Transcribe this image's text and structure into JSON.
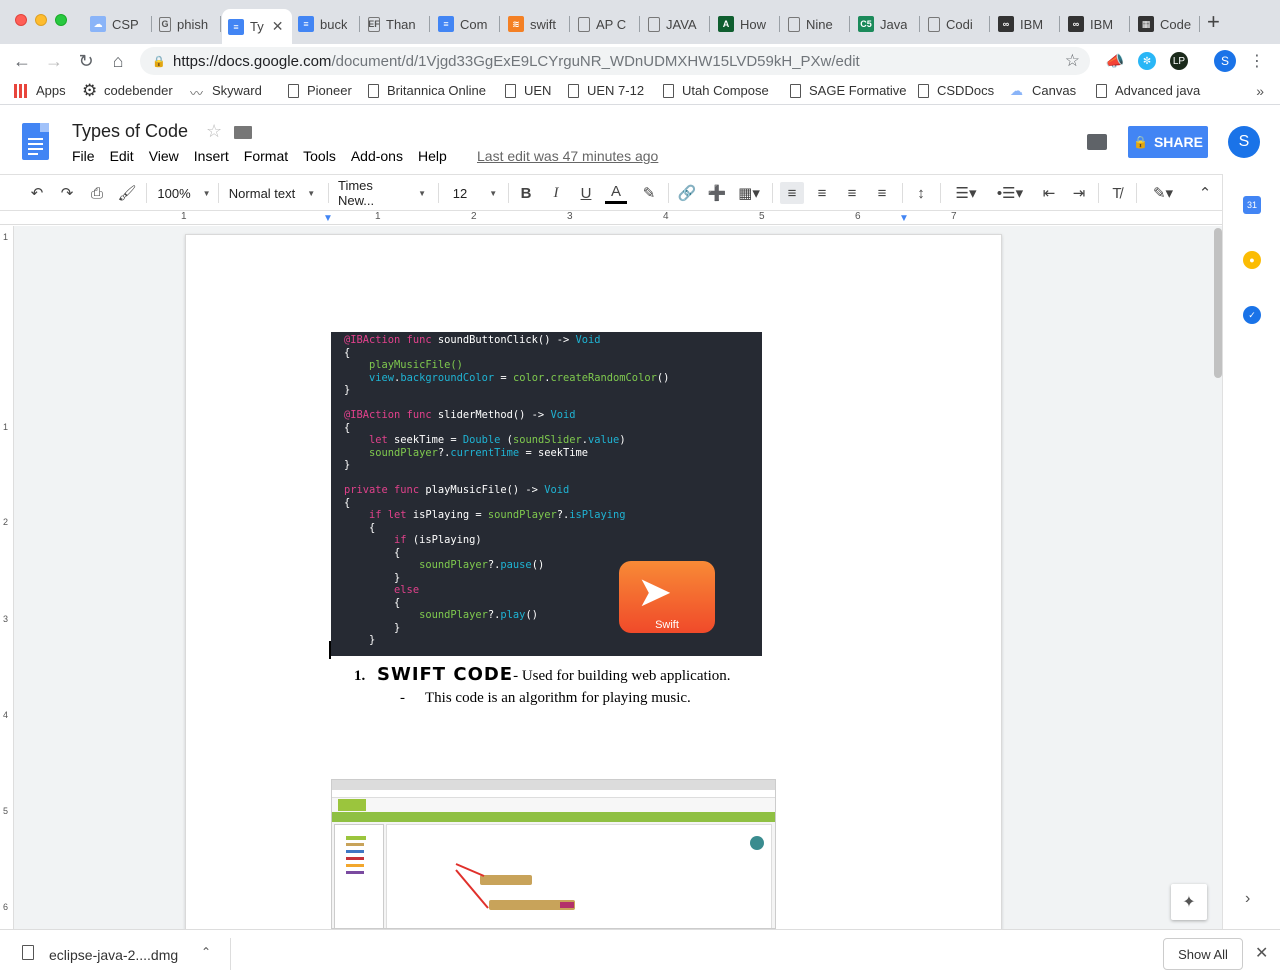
{
  "browser": {
    "tabs": [
      {
        "label": "CSP",
        "fav_color": "#8ab4f8",
        "fav": "☁"
      },
      {
        "label": "phish",
        "fav_color": "#ffffff",
        "fav": "G"
      },
      {
        "label": "Ty",
        "fav_color": "#4285f4",
        "fav": "≡"
      },
      {
        "label": "buck",
        "fav_color": "#4285f4",
        "fav": "≡"
      },
      {
        "label": "Than",
        "fav_color": "#ffffff",
        "fav": "EF"
      },
      {
        "label": "Com",
        "fav_color": "#4285f4",
        "fav": "≡"
      },
      {
        "label": "swift",
        "fav_color": "#f48024",
        "fav": "≋"
      },
      {
        "label": "AP C",
        "fav_color": "#ffffff",
        "fav": ""
      },
      {
        "label": "JAVA",
        "fav_color": "#ffffff",
        "fav": ""
      },
      {
        "label": "How",
        "fav_color": "#0f5e2f",
        "fav": "A"
      },
      {
        "label": "Nine",
        "fav_color": "#ffffff",
        "fav": ""
      },
      {
        "label": "Java",
        "fav_color": "#1b8a5a",
        "fav": "C5"
      },
      {
        "label": "Codi",
        "fav_color": "#ffffff",
        "fav": ""
      },
      {
        "label": "IBM",
        "fav_color": "#333333",
        "fav": "∞"
      },
      {
        "label": "IBM",
        "fav_color": "#333333",
        "fav": "∞"
      },
      {
        "label": "Code",
        "fav_color": "#333333",
        "fav": "▦"
      }
    ],
    "new_tab": "+",
    "url_host": "https://docs.google.com",
    "url_path": "/document/d/1Vjgd33GgExE9LCYrguNR_WDnUDMXHW15LVD59kH_PXw/edit",
    "profile_initial": "S",
    "bookmarks": [
      {
        "label": "Apps",
        "icon": "apps-grid"
      },
      {
        "label": "codebender",
        "icon": "gear"
      },
      {
        "label": "Skyward",
        "icon": "skyward"
      },
      {
        "label": "Pioneer",
        "icon": "doc"
      },
      {
        "label": "Britannica Online",
        "icon": "doc"
      },
      {
        "label": "UEN",
        "icon": "doc"
      },
      {
        "label": "UEN 7-12",
        "icon": "doc"
      },
      {
        "label": "Utah Compose",
        "icon": "doc"
      },
      {
        "label": "SAGE Formative",
        "icon": "doc"
      },
      {
        "label": "CSDDocs",
        "icon": "doc"
      },
      {
        "label": "Canvas",
        "icon": "cloud"
      },
      {
        "label": "Advanced java",
        "icon": "doc"
      }
    ],
    "bookmarks_more": "»"
  },
  "docs": {
    "title": "Types of Code",
    "menu": [
      "File",
      "Edit",
      "View",
      "Insert",
      "Format",
      "Tools",
      "Add-ons",
      "Help"
    ],
    "last_edit": "Last edit was 47 minutes ago",
    "share_label": "SHARE",
    "user_initial": "S",
    "toolbar": {
      "zoom": "100%",
      "style": "Normal text",
      "font": "Times New...",
      "size": "12"
    },
    "ruler_numbers": [
      "1",
      "1",
      "2",
      "3",
      "4",
      "5",
      "6",
      "7"
    ],
    "vruler_numbers": [
      "1",
      "1",
      "2",
      "3",
      "4",
      "5",
      "6"
    ]
  },
  "content": {
    "code_lines": [
      [
        {
          "t": "@IBAction func ",
          "c": "pink"
        },
        {
          "t": "soundButtonClick() -> ",
          "c": "white"
        },
        {
          "t": "Void",
          "c": "blue"
        }
      ],
      [
        {
          "t": "{",
          "c": "white"
        }
      ],
      [
        {
          "t": "    playMusicFile()",
          "c": "green"
        }
      ],
      [
        {
          "t": "    view",
          "c": "blue"
        },
        {
          "t": ".",
          "c": "white"
        },
        {
          "t": "backgroundColor",
          "c": "blue"
        },
        {
          "t": " = ",
          "c": "white"
        },
        {
          "t": "color",
          "c": "green"
        },
        {
          "t": ".",
          "c": "white"
        },
        {
          "t": "createRandomColor",
          "c": "green"
        },
        {
          "t": "()",
          "c": "white"
        }
      ],
      [
        {
          "t": "}",
          "c": "white"
        }
      ],
      [
        {
          "t": "",
          "c": "white"
        }
      ],
      [
        {
          "t": "@IBAction func ",
          "c": "pink"
        },
        {
          "t": "sliderMethod() -> ",
          "c": "white"
        },
        {
          "t": "Void",
          "c": "blue"
        }
      ],
      [
        {
          "t": "{",
          "c": "white"
        }
      ],
      [
        {
          "t": "    let ",
          "c": "pink"
        },
        {
          "t": "seekTime = ",
          "c": "white"
        },
        {
          "t": "Double",
          "c": "blue"
        },
        {
          "t": " (",
          "c": "white"
        },
        {
          "t": "soundSlider",
          "c": "green"
        },
        {
          "t": ".",
          "c": "white"
        },
        {
          "t": "value",
          "c": "blue"
        },
        {
          "t": ")",
          "c": "white"
        }
      ],
      [
        {
          "t": "    soundPlayer",
          "c": "green"
        },
        {
          "t": "?.",
          "c": "white"
        },
        {
          "t": "currentTime",
          "c": "blue"
        },
        {
          "t": " = seekTime",
          "c": "white"
        }
      ],
      [
        {
          "t": "}",
          "c": "white"
        }
      ],
      [
        {
          "t": "",
          "c": "white"
        }
      ],
      [
        {
          "t": "private func ",
          "c": "pink"
        },
        {
          "t": "playMusicFile() -> ",
          "c": "white"
        },
        {
          "t": "Void",
          "c": "blue"
        }
      ],
      [
        {
          "t": "{",
          "c": "white"
        }
      ],
      [
        {
          "t": "    if let ",
          "c": "pink"
        },
        {
          "t": "isPlaying = ",
          "c": "white"
        },
        {
          "t": "soundPlayer",
          "c": "green"
        },
        {
          "t": "?.",
          "c": "white"
        },
        {
          "t": "isPlaying",
          "c": "blue"
        }
      ],
      [
        {
          "t": "    {",
          "c": "white"
        }
      ],
      [
        {
          "t": "        if ",
          "c": "pink"
        },
        {
          "t": "(isPlaying)",
          "c": "white"
        }
      ],
      [
        {
          "t": "        {",
          "c": "white"
        }
      ],
      [
        {
          "t": "            soundPlayer",
          "c": "green"
        },
        {
          "t": "?.",
          "c": "white"
        },
        {
          "t": "pause",
          "c": "blue"
        },
        {
          "t": "()",
          "c": "white"
        }
      ],
      [
        {
          "t": "        }",
          "c": "white"
        }
      ],
      [
        {
          "t": "        else",
          "c": "pink"
        }
      ],
      [
        {
          "t": "        {",
          "c": "white"
        }
      ],
      [
        {
          "t": "            soundPlayer",
          "c": "green"
        },
        {
          "t": "?.",
          "c": "white"
        },
        {
          "t": "play",
          "c": "blue"
        },
        {
          "t": "()",
          "c": "white"
        }
      ],
      [
        {
          "t": "        }",
          "c": "white"
        }
      ],
      [
        {
          "t": "    }",
          "c": "white"
        }
      ]
    ],
    "swift_logo_label": "Swift",
    "list_number": "1.",
    "list_heading": "SWIFT CODE",
    "list_text": "- Used for building web application.",
    "sub_dash": "-",
    "sub_text": "This code is an algorithm for playing music."
  },
  "download": {
    "filename": "eclipse-java-2....dmg",
    "show_all": "Show All"
  },
  "colors": {
    "accent": "#4285f4",
    "code_bg": "#262a33",
    "code_pink": "#e0418b",
    "code_blue": "#1fb3d3",
    "code_green": "#7fc94e"
  }
}
